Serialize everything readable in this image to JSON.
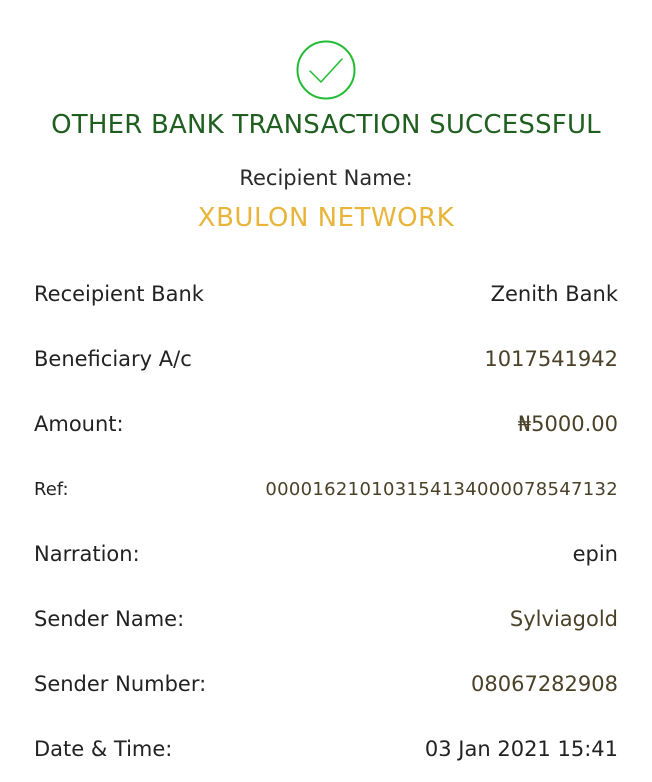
{
  "status": {
    "title": "OTHER BANK TRANSACTION SUCCESSFUL",
    "icon": "check-circle-icon",
    "accent_color": "#22bb33",
    "title_color": "#1f5f1f"
  },
  "recipient": {
    "label": "Recipient Name:",
    "name": "XBULON NETWORK",
    "name_color": "#e8b53a"
  },
  "details": [
    {
      "label": "Receipient Bank",
      "value": "Zenith Bank"
    },
    {
      "label": "Beneficiary A/c",
      "value": "1017541942"
    },
    {
      "label": "Amount:",
      "value": "₦5000.00"
    },
    {
      "label": "Ref:",
      "value": "000016210103154134000078547132"
    },
    {
      "label": "Narration:",
      "value": "epin"
    },
    {
      "label": "Sender Name:",
      "value": "Sylviagold"
    },
    {
      "label": "Sender Number:",
      "value": "08067282908"
    },
    {
      "label": "Date & Time:",
      "value": "03 Jan 2021 15:41"
    }
  ]
}
